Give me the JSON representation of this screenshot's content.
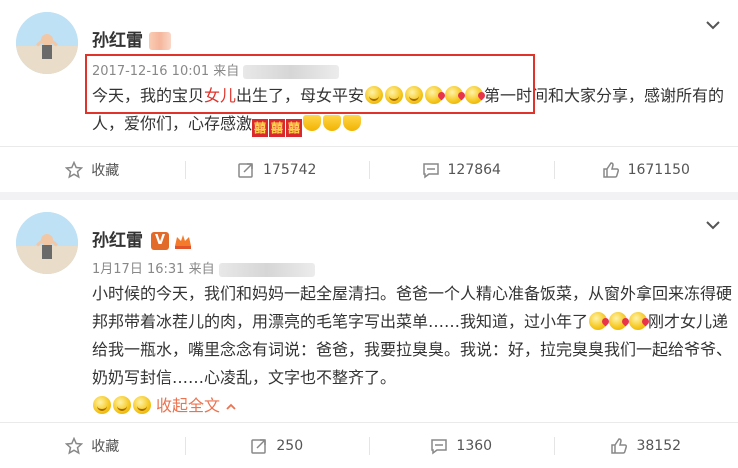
{
  "posts": [
    {
      "author": "孙红雷",
      "timestamp": "2017-12-16 10:01",
      "source_prefix": "来自",
      "content": {
        "part1": "今天，我的宝贝",
        "highlight": "女儿",
        "part2": "出生了，母女平安",
        "part3": "第一时间和大家分享，感谢所有的人，爱你们，心存感激"
      },
      "actions": {
        "favorite": "收藏",
        "repost": "175742",
        "comment": "127864",
        "like": "1671150"
      }
    },
    {
      "author": "孙红雷",
      "timestamp": "1月17日 16:31",
      "source_prefix": "来自",
      "badge": "V",
      "content": {
        "part1": "小时候的今天，我们和妈妈一起全屋清扫。爸爸一个人精心准备饭菜，从窗外拿回来冻得硬邦邦带着冰茬儿的肉，用漂亮的毛笔字写出菜单……我知道，过小年了",
        "part2": "刚才女儿递给我一瓶水，嘴里念念有词说：爸爸，我要拉臭臭。我说：好，拉完臭臭我们一起给爷爷、奶奶写封信……心凌乱，文字也不整齐了。",
        "collapse": "收起全文"
      },
      "actions": {
        "favorite": "收藏",
        "repost": "250",
        "comment": "1360",
        "like": "38152"
      }
    }
  ],
  "colors": {
    "highlight_text": "#e0332a",
    "highlight_box": "#e0332a",
    "link": "#eb7350"
  }
}
